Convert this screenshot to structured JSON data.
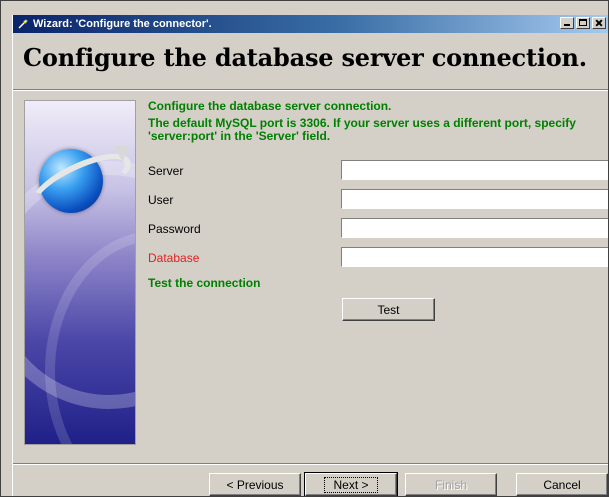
{
  "window": {
    "title": "Wizard: 'Configure the connector'.",
    "minimize_label": "minimize",
    "maximize_label": "maximize",
    "close_label": "close"
  },
  "header": {
    "title": "Configure the database server connection."
  },
  "body": {
    "intro_line": "Configure the database server connection.",
    "port_note": "The default MySQL port is 3306. If your server uses a different port, specify 'server:port' in the 'Server' field.",
    "fields": [
      {
        "label": "Server",
        "value": ""
      },
      {
        "label": "User",
        "value": ""
      },
      {
        "label": "Password",
        "value": ""
      },
      {
        "label": "Database",
        "value": "",
        "label_color": "#e02020"
      }
    ],
    "test_heading": "Test the connection",
    "test_button": "Test"
  },
  "footer": {
    "previous_label": "< Previous",
    "next_label": "Next >",
    "finish_label": "Finish",
    "cancel_label": "Cancel"
  },
  "colors": {
    "title_gradient_start": "#0a246a",
    "title_gradient_end": "#a6caf0",
    "info_text": "#008000",
    "required_label": "#e02020",
    "window_bg": "#d4d0c8"
  },
  "icons": {
    "app": "wizard-icon",
    "side_image": "globe-orbit-illustration"
  }
}
